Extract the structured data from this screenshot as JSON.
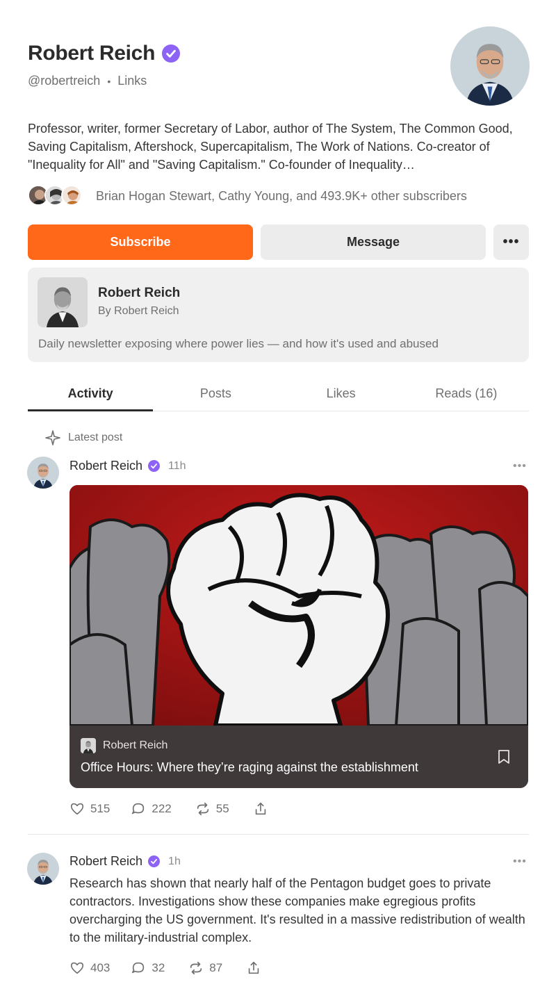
{
  "profile": {
    "name": "Robert Reich",
    "handle": "@robertreich",
    "separator": "•",
    "links_label": "Links",
    "bio": "Professor, writer, former Secretary of Labor, author of The System, The Common Good, Saving Capitalism, Aftershock, Supercapitalism, The Work of Nations. Co-creator of \"Inequality for All\" and \"Saving Capitalism.\" Co-founder of Inequality…",
    "subscribers_text": "Brian Hogan Stewart, Cathy Young, and 493.9K+ other subscribers"
  },
  "buttons": {
    "subscribe": "Subscribe",
    "message": "Message",
    "more": "•••"
  },
  "publication": {
    "title": "Robert Reich",
    "by": "By Robert Reich",
    "description": "Daily newsletter exposing where power lies — and how it's used and abused"
  },
  "tabs": [
    {
      "label": "Activity",
      "active": true
    },
    {
      "label": "Posts",
      "active": false
    },
    {
      "label": "Likes",
      "active": false
    },
    {
      "label": "Reads (16)",
      "active": false
    }
  ],
  "feed": {
    "latest_label": "Latest post",
    "posts": [
      {
        "author": "Robert Reich",
        "time": "11h",
        "more": "•••",
        "card": {
          "publication": "Robert Reich",
          "title": "Office Hours: Where they’re raging against the establishment"
        },
        "likes": "515",
        "comments": "222",
        "restacks": "55"
      },
      {
        "author": "Robert Reich",
        "time": "1h",
        "more": "•••",
        "text": "Research has shown that nearly half of the Pentagon budget goes to private contractors. Investigations show these companies make egregious profits overcharging the US government. It's resulted in a massive redistribution of wealth to the military-industrial complex.",
        "likes": "403",
        "comments": "32",
        "restacks": "87"
      }
    ]
  },
  "colors": {
    "accent": "#ff6719",
    "verified": "#8c63f5",
    "card_footer": "#3f393a",
    "image_background": "#a51515"
  }
}
